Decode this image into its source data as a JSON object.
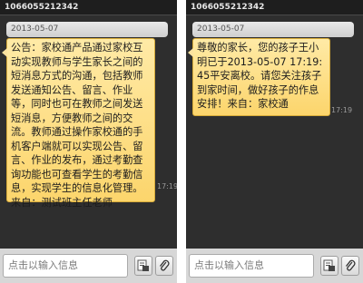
{
  "screens": [
    {
      "sender": "1066055212342",
      "date": "2013-05-07",
      "message": "公告：家校通产品通过家校互动实现教师与学生家长之间的短消息方式的沟通，包括教师发送通知公告、留言、作业等，同时也可在教师之间发送短消息，方便教师之间的交流。教师通过操作家校通的手机客户端就可以实现公告、留言、作业的发布，通过考勤查询功能也可查看学生的考勤信息，实现学生的信息化管理。来自：测试班主任老师",
      "time": "17:19",
      "input_placeholder": "点击以输入信息",
      "icons": [
        "sms-attach-icon",
        "paperclip-icon"
      ]
    },
    {
      "sender": "1066055212342",
      "date": "2013-05-07",
      "message": "尊敬的家长，您的孩子王小明已于2013-05-07 17:19:45平安离校。请您关注孩子到家时间，做好孩子的作息安排！来自：家校通",
      "time": "17:19",
      "input_placeholder": "点击以输入信息",
      "icons": [
        "sms-attach-icon",
        "paperclip-icon"
      ]
    }
  ]
}
